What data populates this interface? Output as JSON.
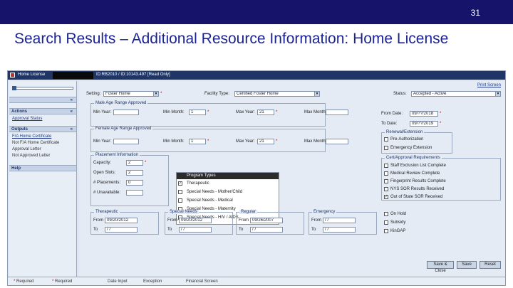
{
  "slide": {
    "number": "31",
    "title": "Search Results – Additional Resource Information: Home License"
  },
  "window": {
    "title_left": "Home License",
    "title_right": "ID:RB2010 / ID:10143.497 [Read Only]",
    "buttons": [
      "_",
      "□",
      "×"
    ]
  },
  "sidebar": {
    "collapse_label": "«",
    "actions_header": "Actions",
    "actions_items": [
      "Approval Status"
    ],
    "outputs_header": "Outputs",
    "outputs_items": [
      "F/A Home Certificate",
      "Not F/A Home Certificate",
      "Approval Letter",
      "Not Approved Letter"
    ],
    "help_header": "Help",
    "chevron": "«"
  },
  "form": {
    "print_screen": "Print Screen",
    "setting_label": "Setting:",
    "setting_value": "Foster Home",
    "facility_type_label": "Facility Type:",
    "facility_type_value": "Certified Foster Home",
    "status_label": "Status:",
    "status_value": "Accepted - Active",
    "male_group_title": "Male Age Range Approved",
    "female_group_title": "Female Age Range Approved",
    "min_year_label": "Min Year:",
    "min_month_label": "Min Month:",
    "max_year_label": "Max Year:",
    "max_month_label": "Max Month:",
    "male_min_month": "1",
    "male_max_year": "21",
    "female_min_month": "1",
    "female_max_year": "21",
    "from_date_label": "From Date:",
    "from_date_value": "09/??/2018",
    "to_date_label": "To Date:",
    "to_date_value": "09/??/2019",
    "renewal_title": "Renewal/Extension",
    "renewal_items": [
      "Pre-Authorization",
      "Emergency Extension"
    ],
    "placement_title": "Placement Information",
    "capacity_label": "Capacity:",
    "capacity_value": "2",
    "open_slots_label": "Open Slots:",
    "open_slots_value": "2",
    "placements_label": "# Placements:",
    "placements_value": "0",
    "unavailable_label": "# Unavailable:",
    "unavailable_value": "",
    "program_types_header": "Program Types",
    "program_types": [
      {
        "label": "Therapeutic",
        "checked": true
      },
      {
        "label": "Special Needs - Mother/Child",
        "checked": false
      },
      {
        "label": "Special Needs - Medical",
        "checked": false
      },
      {
        "label": "Special Needs - Maternity",
        "checked": false
      },
      {
        "label": "Special Needs - HIV / AIDS",
        "checked": false
      }
    ],
    "approval_req_title": "Cert/Approval Requirements",
    "approval_reqs": [
      {
        "label": "Staff Exclusion List Complete",
        "checked": false
      },
      {
        "label": "Medical Review Complete",
        "checked": false
      },
      {
        "label": "Fingerprint Results Complete",
        "checked": false
      },
      {
        "label": "NYS SOR Results Received",
        "checked": false
      },
      {
        "label": "Out of State SOR Received",
        "checked": true
      }
    ],
    "date_groups": [
      {
        "title": "Therapeutic",
        "from": "09/20/2012",
        "to": "/ /"
      },
      {
        "title": "Special Needs",
        "from": "09/20/2012",
        "to": "/ /"
      },
      {
        "title": "Regular",
        "from": "09/26/2007",
        "to": "/ /"
      },
      {
        "title": "Emergency",
        "from": "/ /",
        "to": "/ /"
      }
    ],
    "from_label": "From",
    "to_label": "To",
    "right_checks": [
      "On Hold",
      "Subsidy",
      "KinGAP"
    ],
    "buttons": [
      "Save & Close",
      "Save",
      "Reset"
    ]
  },
  "footer": {
    "legend": [
      "Required",
      "Required",
      "Date Input",
      "Exception",
      "Financial Screen"
    ]
  },
  "colors": {
    "banner": "#15146a",
    "title_text": "#1c2494",
    "window_titlebar": "#1f3565",
    "form_bg": "#e4ebf5"
  }
}
